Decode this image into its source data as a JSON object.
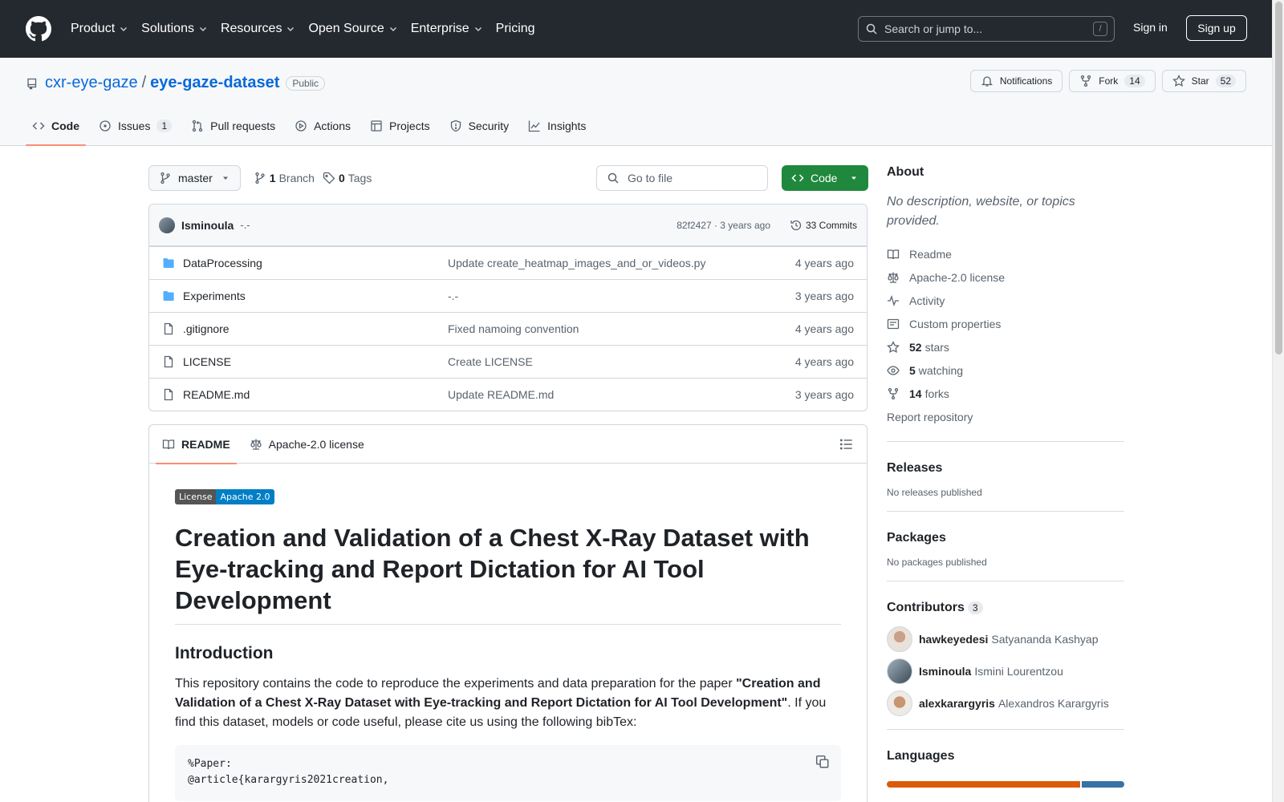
{
  "header": {
    "nav": [
      "Product",
      "Solutions",
      "Resources",
      "Open Source",
      "Enterprise",
      "Pricing"
    ],
    "search_placeholder": "Search or jump to...",
    "search_shortcut": "/",
    "sign_in": "Sign in",
    "sign_up": "Sign up"
  },
  "repo": {
    "owner": "cxr-eye-gaze",
    "separator": "/",
    "name": "eye-gaze-dataset",
    "visibility": "Public",
    "notifications_label": "Notifications",
    "fork_label": "Fork",
    "fork_count": "14",
    "star_label": "Star",
    "star_count": "52",
    "tabs": {
      "code": "Code",
      "issues": "Issues",
      "issues_count": "1",
      "pulls": "Pull requests",
      "actions": "Actions",
      "projects": "Projects",
      "security": "Security",
      "insights": "Insights"
    }
  },
  "toolbar": {
    "branch": "master",
    "branch_count": "1",
    "branch_label": "Branch",
    "tag_count": "0",
    "tag_label": "Tags",
    "goto_placeholder": "Go to file",
    "code_button": "Code"
  },
  "commit": {
    "author": "Isminoula",
    "message": "-.-",
    "hash_age": "82f2427 · 3 years ago",
    "commits": "33 Commits"
  },
  "files": [
    {
      "name": "DataProcessing",
      "message": "Update create_heatmap_images_and_or_videos.py",
      "age": "4 years ago"
    },
    {
      "name": "Experiments",
      "message": "-.-",
      "age": "3 years ago"
    },
    {
      "name": ".gitignore",
      "message": "Fixed namoing convention",
      "age": "4 years ago"
    },
    {
      "name": "LICENSE",
      "message": "Create LICENSE",
      "age": "4 years ago"
    },
    {
      "name": "README.md",
      "message": "Update README.md",
      "age": "3 years ago"
    }
  ],
  "readme": {
    "tab_readme": "README",
    "tab_license": "Apache-2.0 license",
    "badge_left": "License",
    "badge_right": "Apache 2.0",
    "title": "Creation and Validation of a Chest X-Ray Dataset with Eye-tracking and Report Dictation for AI Tool Development",
    "intro_heading": "Introduction",
    "intro_pre": "This repository contains the code to reproduce the experiments and data preparation for the paper ",
    "intro_bold": "\"Creation and Validation of a Chest X-Ray Dataset with Eye-tracking and Report Dictation for AI Tool Development\"",
    "intro_post": ". If you find this dataset, models or code useful, please cite us using the following bibTex:",
    "code_line1": "%Paper:",
    "code_line2": "@article{karargyris2021creation,"
  },
  "about": {
    "heading": "About",
    "description": "No description, website, or topics provided.",
    "readme": "Readme",
    "license": "Apache-2.0 license",
    "activity": "Activity",
    "custom_properties": "Custom properties",
    "stars_count": "52",
    "stars_label": "stars",
    "watching_count": "5",
    "watching_label": "watching",
    "forks_count": "14",
    "forks_label": "forks",
    "report": "Report repository"
  },
  "releases": {
    "heading": "Releases",
    "text": "No releases published"
  },
  "packages": {
    "heading": "Packages",
    "text": "No packages published"
  },
  "contributors": {
    "heading": "Contributors",
    "count": "3",
    "people": [
      {
        "login": "hawkeyedesi",
        "name": "Satyananda Kashyap"
      },
      {
        "login": "Isminoula",
        "name": "Ismini Lourentzou"
      },
      {
        "login": "alexkarargyris",
        "name": "Alexandros Karargyris"
      }
    ]
  },
  "languages": {
    "heading": "Languages",
    "bar_colors": [
      "#DA5B0B",
      "#3572A5"
    ],
    "bar_shares": [
      0.82,
      0.18
    ]
  }
}
